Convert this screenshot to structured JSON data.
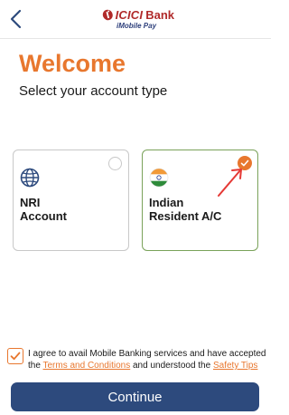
{
  "header": {
    "back_icon": "chevron-left-icon",
    "logo_brand": "ICICI",
    "logo_bank": "Bank",
    "logo_sub": "iMobile Pay",
    "brand_color": "#b02a2a"
  },
  "main": {
    "title": "Welcome",
    "subtitle": "Select your account type",
    "accent_color": "#e8772e"
  },
  "account_types": [
    {
      "line1": "NRI",
      "line2": "Account",
      "icon": "globe-icon",
      "selected": false
    },
    {
      "line1": "Indian",
      "line2": "Resident A/C",
      "icon": "india-flag-icon",
      "selected": true
    }
  ],
  "consent": {
    "checked": true,
    "text_part1": "I agree to avail Mobile Banking services and have accepted the ",
    "terms_link": "Terms and Conditions",
    "text_part2": " and understood the ",
    "safety_link": "Safety Tips"
  },
  "footer": {
    "continue_label": "Continue",
    "button_color": "#2d4a7d"
  }
}
